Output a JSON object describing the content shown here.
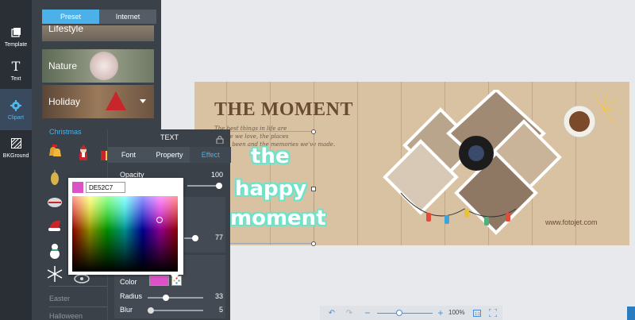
{
  "rail": {
    "items": [
      {
        "label": "Template",
        "icon": "template-icon"
      },
      {
        "label": "Text",
        "icon": "text-icon"
      },
      {
        "label": "Clipart",
        "icon": "clipart-icon"
      },
      {
        "label": "BKGround",
        "icon": "background-icon"
      }
    ],
    "active": "Clipart"
  },
  "panel": {
    "tabs": [
      "Preset",
      "Internet"
    ],
    "categories": [
      "Lifestyle",
      "Nature",
      "Holiday"
    ],
    "section_title": "Christmas",
    "links": [
      "Easter",
      "Halloween"
    ]
  },
  "canvas": {
    "title": "THE MOMENT",
    "body": "The best things in life are\npeople we love, the places\nwe've been and the memories we've made.",
    "url": "www.fotojet.com",
    "overlay": [
      "the",
      "happy",
      "moment"
    ]
  },
  "dialog": {
    "title": "TEXT",
    "tabs": [
      "Font",
      "Property",
      "Effect"
    ],
    "active_tab": "Effect",
    "opacity_label": "Opacity",
    "opacity_value": "100",
    "opacity_level": 1.0,
    "mid_value": "77",
    "mid_level": 0.77,
    "color_label": "Color",
    "radius_label": "Radius",
    "radius_value": "33",
    "radius_level": 0.33,
    "blur_label": "Blur",
    "blur_value": "5",
    "blur_level": 0.05
  },
  "picker": {
    "hex": "DE52C7"
  },
  "zoombar": {
    "zoom": "100%",
    "zoom_level": 0.4
  },
  "colors": {
    "accent": "#4cb1e8",
    "picked": "#DE52C7",
    "overlay_stroke": "#6ee3c9"
  }
}
